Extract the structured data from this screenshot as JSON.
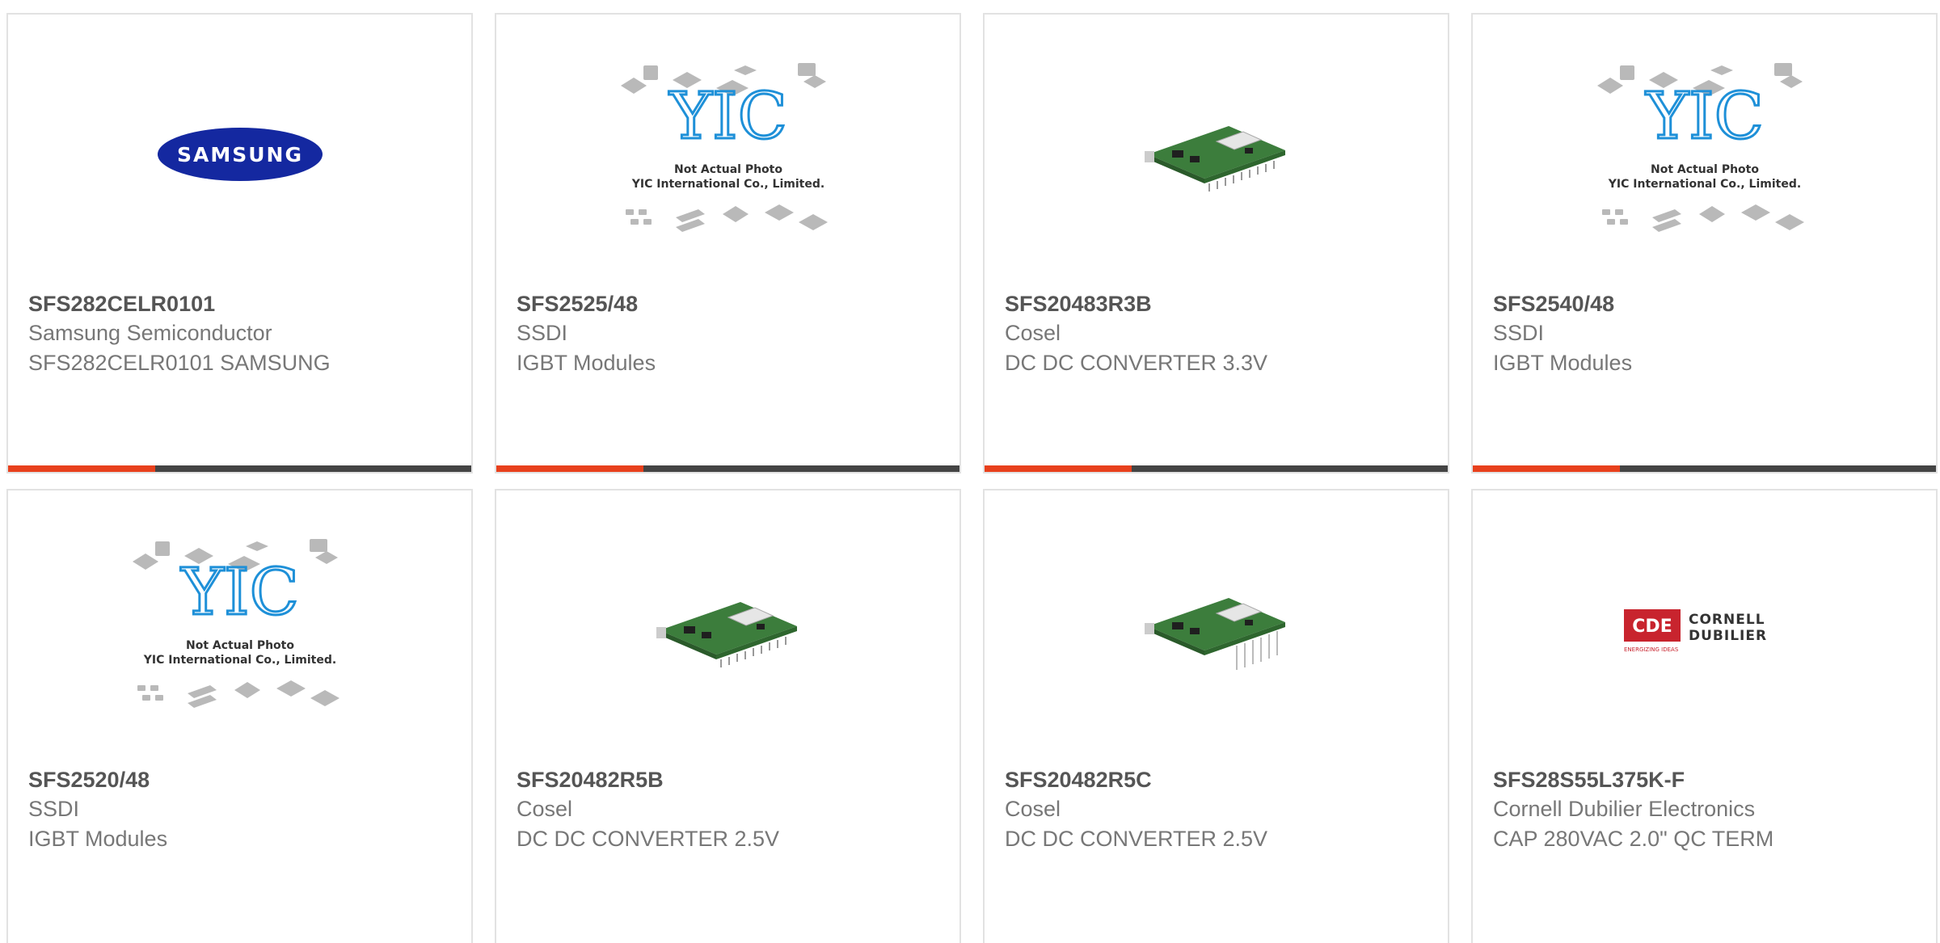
{
  "colors": {
    "accent": "#e8401c",
    "bar_dark": "#444444",
    "border": "#e2e2e2",
    "part_number": "#555555",
    "meta_text": "#777777",
    "samsung_blue": "#1428a0",
    "yic_blue": "#1e90d8",
    "cde_red": "#c8242e"
  },
  "cards": [
    {
      "part_number": "SFS282CELR0101",
      "manufacturer": "Samsung Semiconductor",
      "description": "SFS282CELR0101 SAMSUNG",
      "image": "samsung-logo",
      "logo_text": "SAMSUNG"
    },
    {
      "part_number": "SFS2525/48",
      "manufacturer": "SSDI",
      "description": "IGBT Modules",
      "image": "yic-placeholder",
      "placeholder_line1": "Not Actual Photo",
      "placeholder_line2": "YIC International Co., Limited."
    },
    {
      "part_number": "SFS20483R3B",
      "manufacturer": "Cosel",
      "description": "DC DC CONVERTER 3.3V",
      "image": "dc-converter-board"
    },
    {
      "part_number": "SFS2540/48",
      "manufacturer": "SSDI",
      "description": "IGBT Modules",
      "image": "yic-placeholder",
      "placeholder_line1": "Not Actual Photo",
      "placeholder_line2": "YIC International Co., Limited."
    },
    {
      "part_number": "SFS2520/48",
      "manufacturer": "SSDI",
      "description": "IGBT Modules",
      "image": "yic-placeholder",
      "placeholder_line1": "Not Actual Photo",
      "placeholder_line2": "YIC International Co., Limited."
    },
    {
      "part_number": "SFS20482R5B",
      "manufacturer": "Cosel",
      "description": "DC DC CONVERTER 2.5V",
      "image": "dc-converter-board"
    },
    {
      "part_number": "SFS20482R5C",
      "manufacturer": "Cosel",
      "description": "DC DC CONVERTER 2.5V",
      "image": "dc-converter-board"
    },
    {
      "part_number": "SFS28S55L375K-F",
      "manufacturer": "Cornell Dubilier Electronics",
      "description": "CAP 280VAC 2.0\" QC TERM",
      "image": "cde-logo",
      "logo_mark": "CDE",
      "logo_line1": "CORNELL",
      "logo_line2": "DUBILIER",
      "logo_tagline": "ENERGIZING IDEAS"
    }
  ]
}
